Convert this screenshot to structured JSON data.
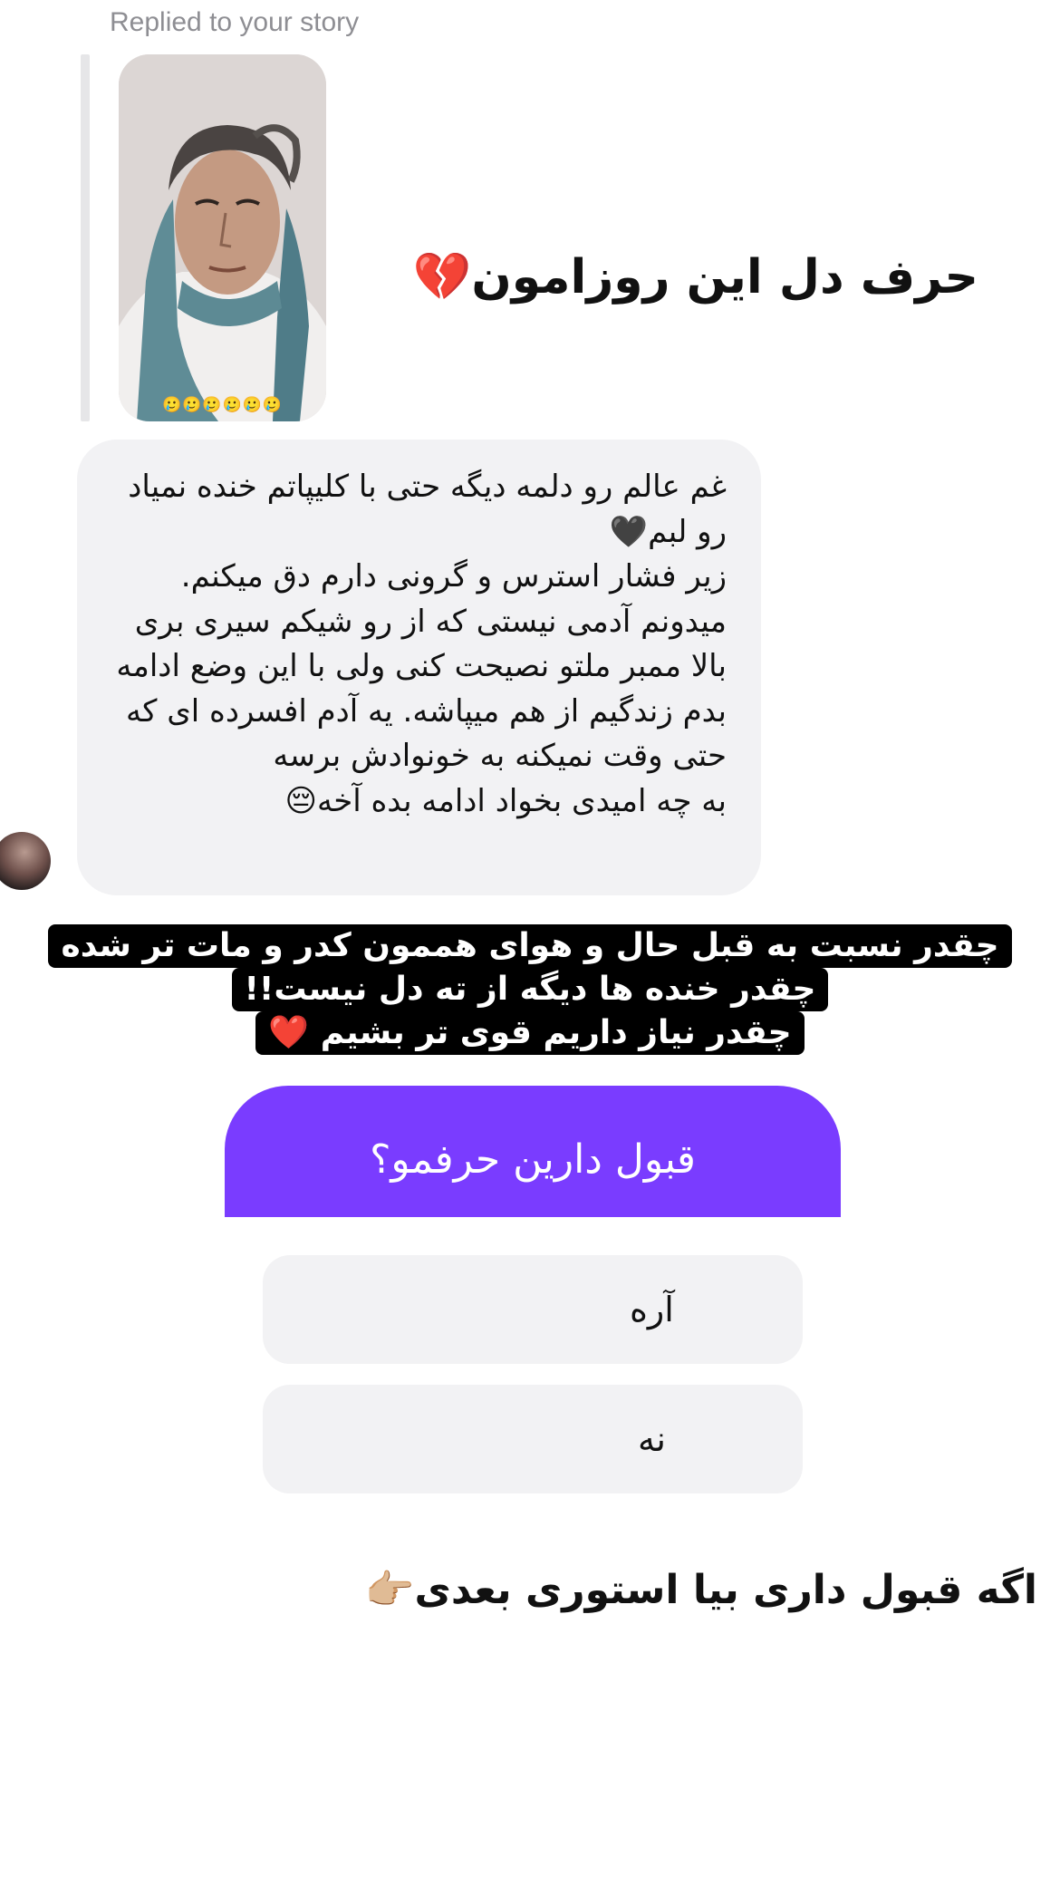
{
  "reply": {
    "label": "Replied to your story",
    "thumbnail_emojis": "🥲🥲🥲🥲🥲🥲"
  },
  "story_headline": {
    "text": "حرف دل این روزامون",
    "emoji": "💔"
  },
  "message": {
    "text": "غم عالم رو دلمه دیگه حتی با کلیپاتم خنده نمیاد رو لبم🖤\nزیر فشار استرس و گرونی دارم دق میکنم. میدونم آدمی نیستی که از رو شیکم سیری بری بالا ممبر ملتو نصیحت کنی ولی با این وضع ادامه بدم زندگیم از هم میپاشه. یه آدم افسرده ای که حتی وقت نمیکنه به خونوادش برسه\nبه چه امیدی بخواد ادامه بده آخه😔"
  },
  "caption": {
    "line1": "چقدر نسبت به قبل حال و هوای هممون کدر و مات تر شده",
    "line2": "چقدر خنده ها دیگه از ته دل نیست!!",
    "line3": "چقدر نیاز داریم قوی تر بشیم",
    "line3_emoji": "❤️"
  },
  "poll": {
    "question": "قبول دارین حرفمو؟",
    "options": [
      {
        "label": "آره"
      },
      {
        "label": "نه"
      }
    ],
    "header_color": "#7a3cff"
  },
  "footer": {
    "text": "اگه قبول داری بیا استوری بعدی",
    "emoji": "👉🏼"
  }
}
